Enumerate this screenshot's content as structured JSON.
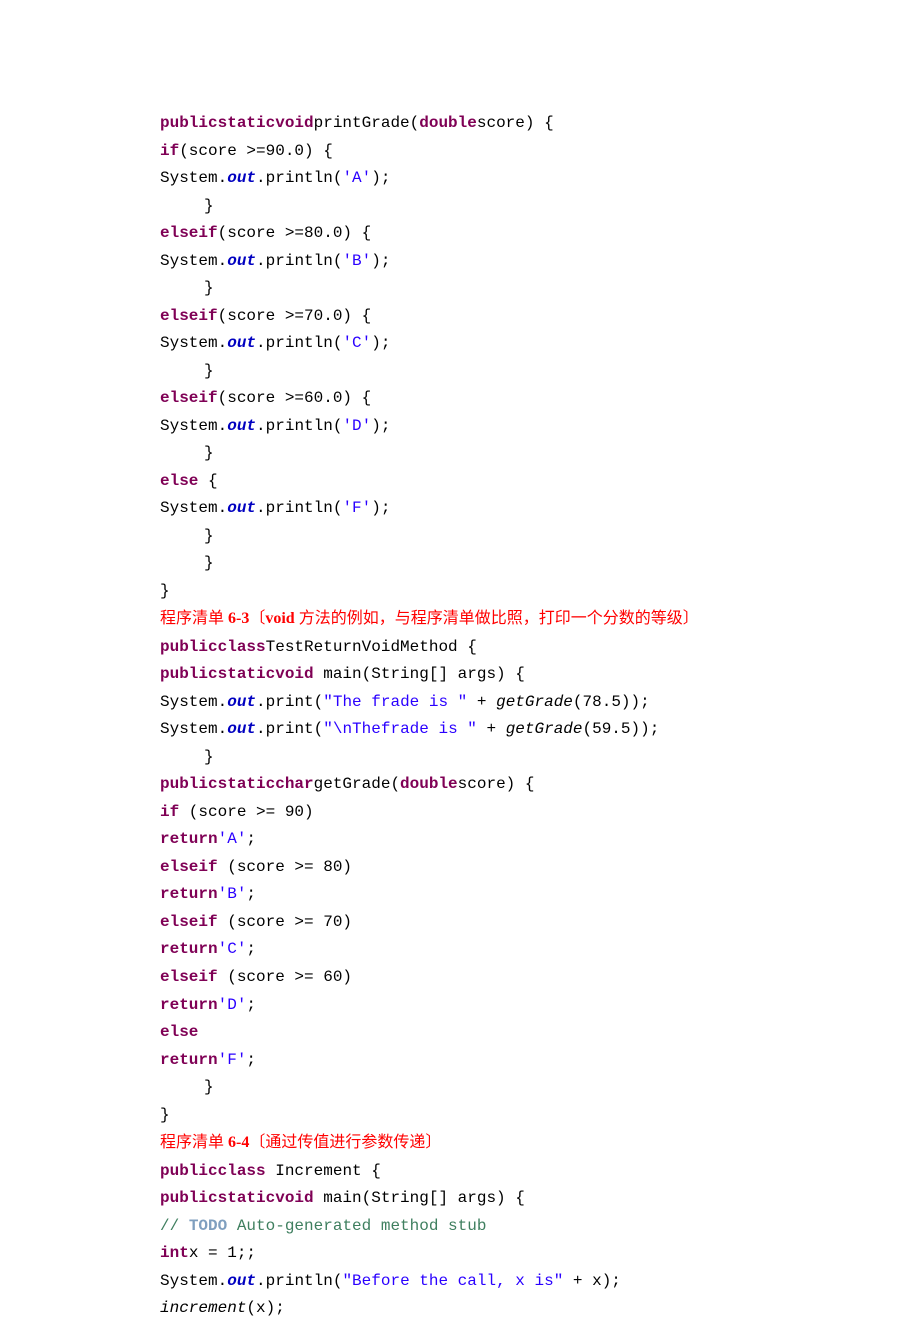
{
  "lines": {
    "l1a": "publicstaticvoid",
    "l1b": "printGrade(",
    "l1c": "double",
    "l1d": "score) {",
    "l2a": "if",
    "l2b": "(score >=90.0) {",
    "l3a": "System.",
    "l3b": "out",
    "l3c": ".println(",
    "l3d": "'A'",
    "l3e": ");",
    "l4": "}",
    "l5a": "elseif",
    "l5b": "(score >=80.0) {",
    "l6a": "System.",
    "l6b": "out",
    "l6c": ".println(",
    "l6d": "'B'",
    "l6e": ");",
    "l7": "}",
    "l8a": "elseif",
    "l8b": "(score >=70.0) {",
    "l9a": "System.",
    "l9b": "out",
    "l9c": ".println(",
    "l9d": "'C'",
    "l9e": ");",
    "l10": "}",
    "l11a": "elseif",
    "l11b": "(score >=60.0) {",
    "l12a": "System.",
    "l12b": "out",
    "l12c": ".println(",
    "l12d": "'D'",
    "l12e": ");",
    "l13": "}",
    "l14a": "else",
    "l14b": " {",
    "l15a": "System.",
    "l15b": "out",
    "l15c": ".println(",
    "l15d": "'F'",
    "l15e": ");",
    "l16": "}",
    "l17": "}",
    "l18": "}",
    "h1a": "程序清单 ",
    "h1b": "6-3",
    "h1c": "〔",
    "h1d": "void ",
    "h1e": "方法的例如，与程序清单做比照，打印一个分数的等级〕",
    "l19a": "publicclass",
    "l19b": "TestReturnVoidMethod {",
    "l20a": "publicstaticvoid",
    "l20b": " main(String[] args) {",
    "l21a": "System.",
    "l21b": "out",
    "l21c": ".print(",
    "l21d": "\"The frade is \"",
    "l21e": " + ",
    "l21f": "getGrade",
    "l21g": "(78.5));",
    "l22a": "System.",
    "l22b": "out",
    "l22c": ".print(",
    "l22d": "\"\\nThefrade is \"",
    "l22e": " + ",
    "l22f": "getGrade",
    "l22g": "(59.5));",
    "l23": "}",
    "l24a": "publicstaticchar",
    "l24b": "getGrade(",
    "l24c": "double",
    "l24d": "score) {",
    "l25a": "if",
    "l25b": " (score >= 90)",
    "l26a": "return",
    "l26b": "'A'",
    "l26c": ";",
    "l27a": "elseif",
    "l27b": " (score >= 80)",
    "l28a": "return",
    "l28b": "'B'",
    "l28c": ";",
    "l29a": "elseif",
    "l29b": " (score >= 70)",
    "l30a": "return",
    "l30b": "'C'",
    "l30c": ";",
    "l31a": "elseif",
    "l31b": " (score >= 60)",
    "l32a": "return",
    "l32b": "'D'",
    "l32c": ";",
    "l33a": "else",
    "l34a": "return",
    "l34b": "'F'",
    "l34c": ";",
    "l35": "}",
    "l36": "}",
    "h2a": "程序清单 ",
    "h2b": "6-4",
    "h2c": "〔通过传值进行参数传递〕",
    "l37a": "publicclass",
    "l37b": " Increment {",
    "l38a": "publicstaticvoid",
    "l38b": " main(String[] args) {",
    "l39a": "// ",
    "l39b": "TODO",
    "l39c": " Auto-generated method stub",
    "l40a": "int",
    "l40b": "x = 1;;",
    "l41a": "System.",
    "l41b": "out",
    "l41c": ".println(",
    "l41d": "\"Before the call, x is\"",
    "l41e": " + x);",
    "l42a": "increment",
    "l42b": "(x);"
  }
}
